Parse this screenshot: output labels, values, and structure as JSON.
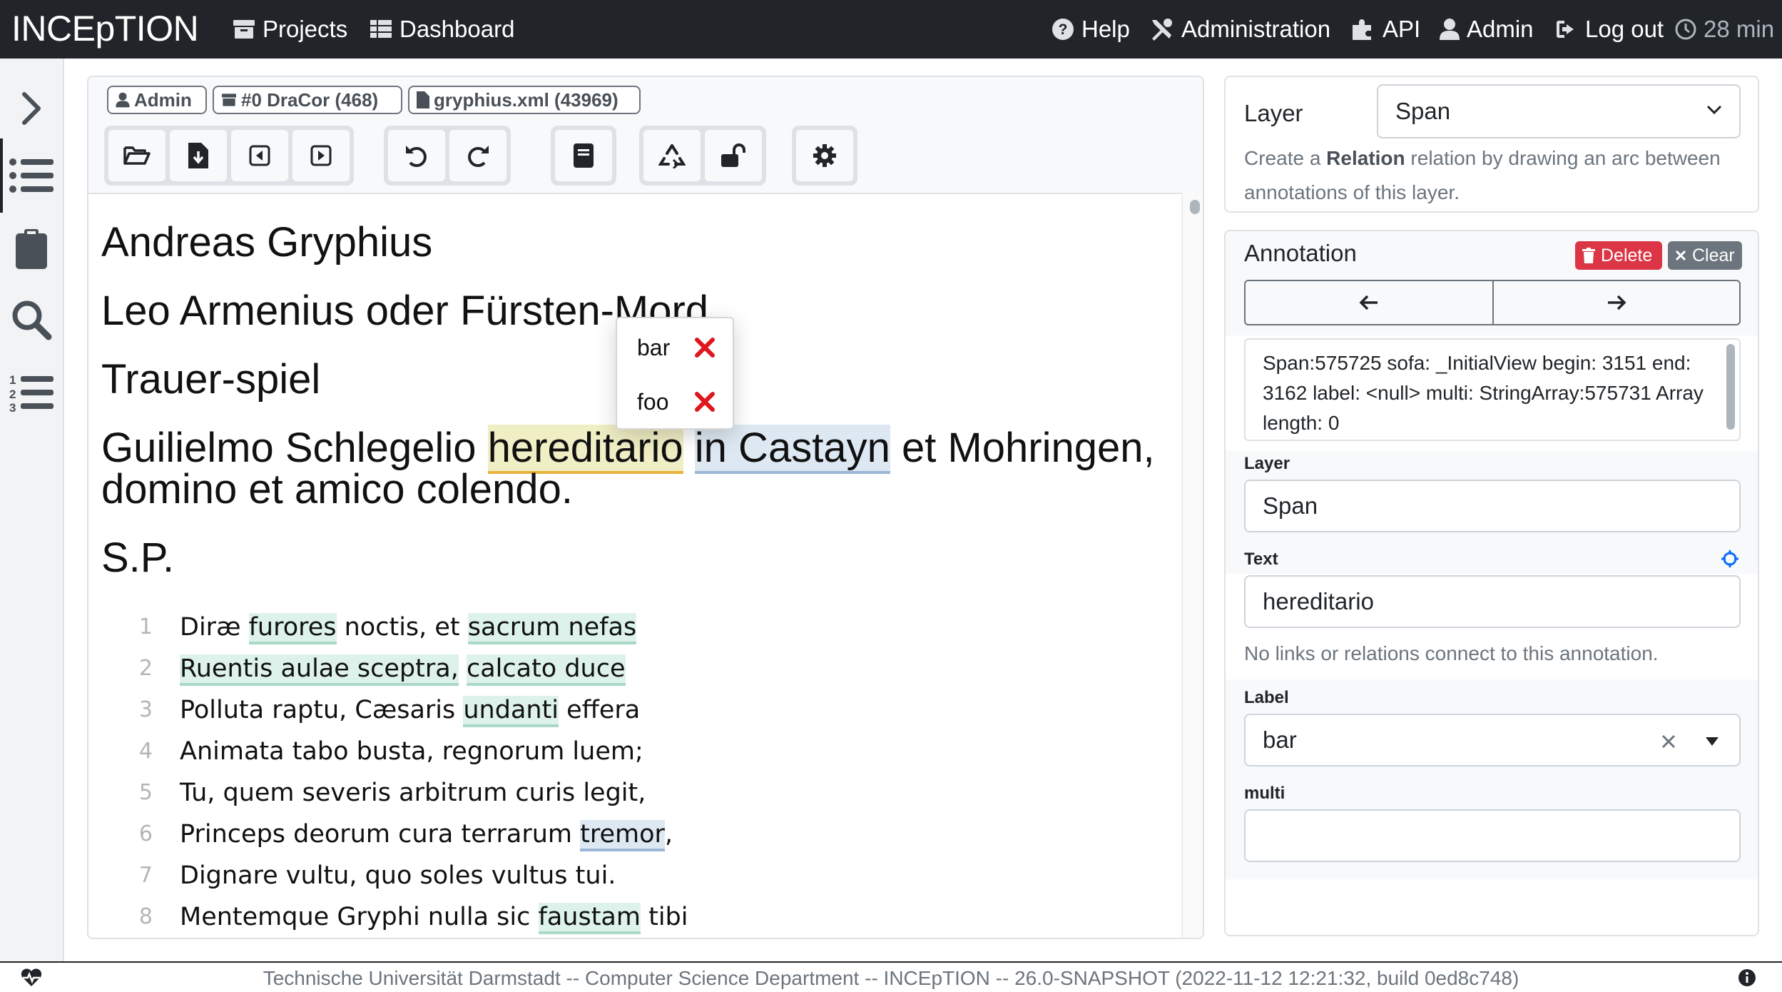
{
  "navbar": {
    "brand": "INCEpTION",
    "projects": "Projects",
    "dashboard": "Dashboard",
    "help": "Help",
    "administration": "Administration",
    "api": "API",
    "admin": "Admin",
    "logout": "Log out",
    "timer": "28 min"
  },
  "editor": {
    "badges": {
      "user": "Admin",
      "project": "#0 DraCor (468)",
      "document": "gryphius.xml (43969)"
    },
    "headings": {
      "h1": "Andreas Gryphius",
      "h2": "Leo Armenius oder Fürsten-Mord",
      "h3": "Trauer-spiel",
      "h4_pre": "Guilielmo Schlegelio ",
      "h4_ann1": "hereditario",
      "h4_mid": " ",
      "h4_ann2": "in Castayn",
      "h4_post": " et Mohringen,",
      "h4_line2": "domino et amico colendo.",
      "h5": "S.P."
    },
    "verses": [
      {
        "n": "1",
        "segments": [
          [
            "Diræ ",
            ""
          ],
          [
            "furores",
            "g"
          ],
          [
            " noctis, et ",
            ""
          ],
          [
            "sacrum nefas",
            "g"
          ]
        ]
      },
      {
        "n": "2",
        "segments": [
          [
            "Ruentis aulae sceptra,",
            "g"
          ],
          [
            " ",
            ""
          ],
          [
            "calcato duce",
            "g"
          ]
        ]
      },
      {
        "n": "3",
        "segments": [
          [
            "Polluta raptu, Cæsaris ",
            ""
          ],
          [
            "undanti",
            "g"
          ],
          [
            " effera",
            ""
          ]
        ]
      },
      {
        "n": "4",
        "segments": [
          [
            "Animata tabo busta, regnorum luem;",
            ""
          ]
        ]
      },
      {
        "n": "5",
        "segments": [
          [
            "Tu, quem severis arbitrum curis legit,",
            ""
          ]
        ]
      },
      {
        "n": "6",
        "segments": [
          [
            "Princeps deorum cura terrarum ",
            ""
          ],
          [
            "tremor",
            "b"
          ],
          [
            ",",
            ""
          ]
        ]
      },
      {
        "n": "7",
        "segments": [
          [
            "Dignare vultu, quo soles vultus tui.",
            ""
          ]
        ]
      },
      {
        "n": "8",
        "segments": [
          [
            "Mentemque Gryphi nulla sic ",
            ""
          ],
          [
            "faustam",
            "g"
          ],
          [
            " tibi",
            ""
          ]
        ]
      }
    ],
    "popup": {
      "item1": "bar",
      "item2": "foo"
    }
  },
  "layer_panel": {
    "label": "Layer",
    "selected": "Span",
    "help_pre": "Create a ",
    "help_bold": "Relation",
    "help_post": " relation by drawing an arc between",
    "help_line2": "annotations of this layer."
  },
  "annotation_panel": {
    "title": "Annotation",
    "delete": "Delete",
    "clear": "Clear",
    "info": "Span:575725 sofa: _InitialView begin: 3151 end: 3162 label: <null> multi: StringArray:575731 Array length: 0",
    "layer_label": "Layer",
    "layer_value": "Span",
    "text_label": "Text",
    "text_value": "hereditario",
    "no_links": "No links or relations connect to this annotation.",
    "label_label": "Label",
    "label_value": "bar",
    "multi_label": "multi",
    "multi_value": ""
  },
  "footer": {
    "text": "Technische Universität Darmstadt -- Computer Science Department -- INCEpTION -- 26.0-SNAPSHOT (2022-11-12 12:21:32, build 0ed8c748)"
  },
  "colors": {
    "navbar": "#212529",
    "delete": "#dc3545",
    "clear": "#6c757d",
    "annotation_green": "#ddf2ea",
    "annotation_blue": "#dde8f2",
    "annotation_yellow": "#f0eec4"
  }
}
